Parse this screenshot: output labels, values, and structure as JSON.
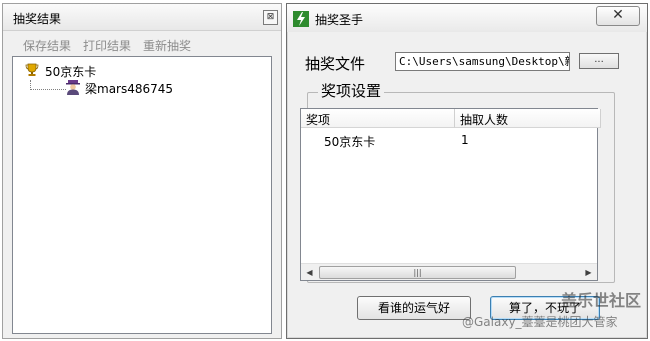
{
  "left_panel": {
    "title": "抽奖结果",
    "close_glyph": "⊠",
    "toolbar": [
      "保存结果",
      "打印结果",
      "重新抽奖"
    ],
    "tree": {
      "root_label": "50京东卡",
      "child_label": "梁mars486745"
    }
  },
  "dialog": {
    "title": "抽奖圣手",
    "close_glyph": "✕",
    "file_label": "抽奖文件",
    "file_path": "C:\\Users\\samsung\\Desktop\\新建",
    "browse_label": "...",
    "group_label": "奖项设置",
    "table": {
      "columns": [
        "奖项",
        "抽取人数"
      ],
      "rows": [
        [
          "50京东卡",
          "1"
        ]
      ]
    },
    "scroll_left": "◀",
    "scroll_right": "▶",
    "scroll_grip": "|||",
    "buttons": {
      "draw": "看谁的运气好",
      "quit": "算了，不玩了"
    }
  },
  "watermark": {
    "line1": "盖乐世社区",
    "line2": "@Galaxy_薹薹是桃团大管家"
  },
  "colors": {
    "app_icon": "#2e8b2e",
    "toolbar_disabled": "#8c8c8c"
  }
}
